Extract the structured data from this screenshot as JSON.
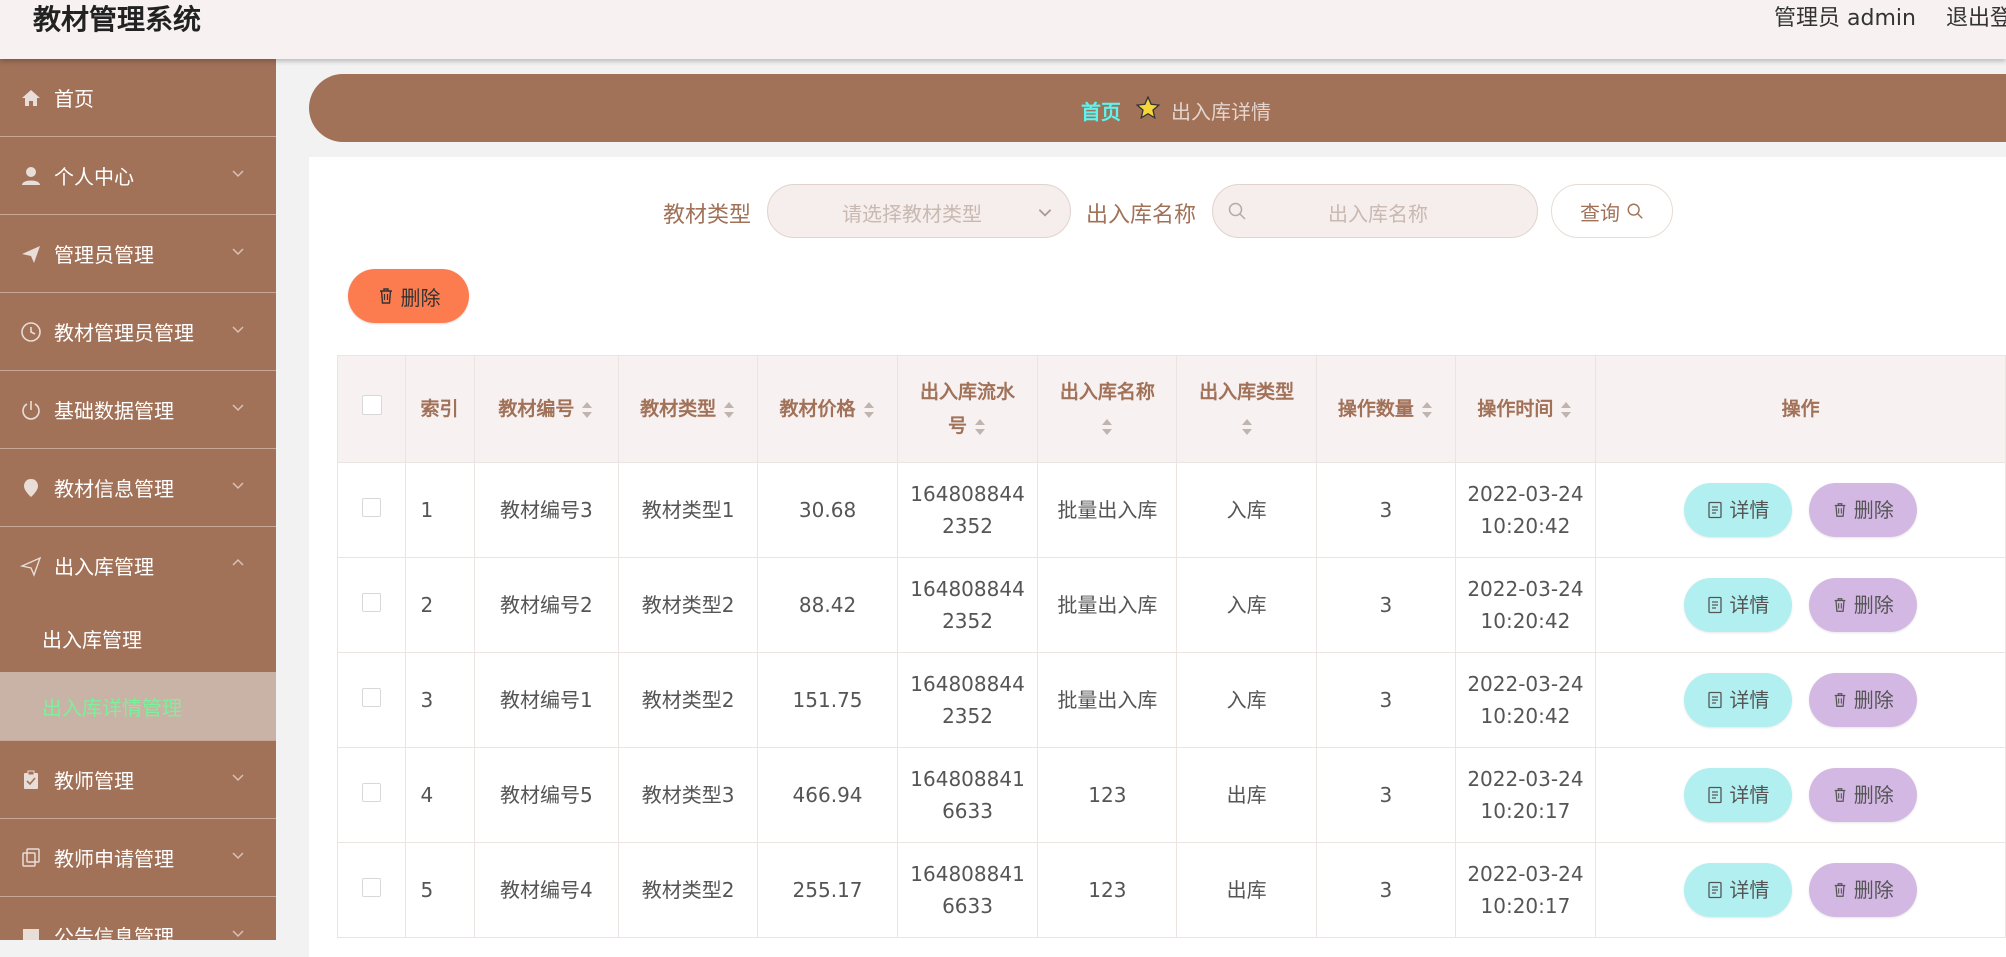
{
  "header": {
    "title": "教材管理系统",
    "user": "管理员 admin",
    "logout": "退出登录"
  },
  "sidebar": {
    "items": [
      {
        "label": "首页",
        "icon": "home-icon"
      },
      {
        "label": "个人中心",
        "icon": "user-icon"
      },
      {
        "label": "管理员管理",
        "icon": "send-icon"
      },
      {
        "label": "教材管理员管理",
        "icon": "clock-icon"
      },
      {
        "label": "基础数据管理",
        "icon": "power-icon"
      },
      {
        "label": "教材信息管理",
        "icon": "location-icon"
      },
      {
        "label": "出入库管理",
        "icon": "send-icon"
      }
    ],
    "sub_items": [
      {
        "label": "出入库管理"
      },
      {
        "label": "出入库详情管理"
      }
    ],
    "items_after": [
      {
        "label": "教师管理",
        "icon": "clipboard-icon"
      },
      {
        "label": "教师申请管理",
        "icon": "copy-icon"
      },
      {
        "label": "公告信息管理",
        "icon": "chat-icon"
      }
    ]
  },
  "breadcrumb": {
    "home": "首页",
    "current": "出入库详情"
  },
  "search": {
    "type_label": "教材类型",
    "type_placeholder": "请选择教材类型",
    "name_label": "出入库名称",
    "name_placeholder": "出入库名称",
    "query_label": "查询"
  },
  "toolbar": {
    "delete_label": "删除"
  },
  "table": {
    "headers": {
      "index": "索引",
      "code": "教材编号",
      "type": "教材类型",
      "price": "教材价格",
      "serial_a": "出入库流水",
      "serial_b": "号",
      "name": "出入库名称",
      "kind": "出入库类型",
      "qty": "操作数量",
      "time": "操作时间",
      "ops": "操作"
    },
    "rows": [
      {
        "index": "1",
        "code": "教材编号3",
        "type": "教材类型1",
        "price": "30.68",
        "serial_a": "164808844",
        "serial_b": "2352",
        "name": "批量出入库",
        "kind": "入库",
        "qty": "3",
        "date": "2022-03-24",
        "time": "10:20:42"
      },
      {
        "index": "2",
        "code": "教材编号2",
        "type": "教材类型2",
        "price": "88.42",
        "serial_a": "164808844",
        "serial_b": "2352",
        "name": "批量出入库",
        "kind": "入库",
        "qty": "3",
        "date": "2022-03-24",
        "time": "10:20:42"
      },
      {
        "index": "3",
        "code": "教材编号1",
        "type": "教材类型2",
        "price": "151.75",
        "serial_a": "164808844",
        "serial_b": "2352",
        "name": "批量出入库",
        "kind": "入库",
        "qty": "3",
        "date": "2022-03-24",
        "time": "10:20:42"
      },
      {
        "index": "4",
        "code": "教材编号5",
        "type": "教材类型3",
        "price": "466.94",
        "serial_a": "164808841",
        "serial_b": "6633",
        "name": "123",
        "kind": "出库",
        "qty": "3",
        "date": "2022-03-24",
        "time": "10:20:17"
      },
      {
        "index": "5",
        "code": "教材编号4",
        "type": "教材类型2",
        "price": "255.17",
        "serial_a": "164808841",
        "serial_b": "6633",
        "name": "123",
        "kind": "出库",
        "qty": "3",
        "date": "2022-03-24",
        "time": "10:20:17"
      }
    ],
    "row_actions": {
      "detail": "详情",
      "delete": "删除"
    }
  },
  "colors": {
    "brand": "#a17158",
    "accent_text": "#5ef3ec",
    "delete_button": "#fd7c4f",
    "detail_button": "#b2eff0",
    "row_delete_button": "#d4b8e4",
    "active_sub_text": "#7cf09a"
  }
}
